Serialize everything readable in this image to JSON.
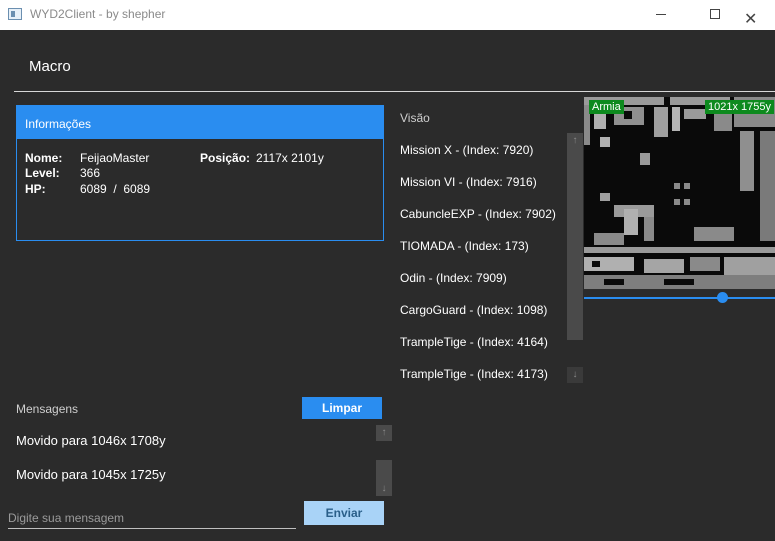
{
  "window": {
    "title": "WYD2Client - by shepher"
  },
  "header": {
    "tab_label": "Macro"
  },
  "info": {
    "title": "Informações",
    "name_label": "Nome:",
    "name_value": "FeijaoMaster",
    "position_label": "Posição:",
    "position_value": "2117x 2101y",
    "level_label": "Level:",
    "level_value": "366",
    "hp_label": "HP:",
    "hp_value": "6089  /  6089"
  },
  "vision": {
    "title": "Visão",
    "items": [
      "Mission X  - (Index: 7920)",
      "Mission VI  - (Index: 7916)",
      "CabuncleEXP  - (Index: 7902)",
      "TIOMADA  - (Index: 173)",
      "Odin  - (Index: 7909)",
      "CargoGuard  - (Index: 1098)",
      "TrampleTige  - (Index: 4164)",
      "TrampleTige  - (Index: 4173)"
    ]
  },
  "map": {
    "region_label": "Armia",
    "coords_label": "1021x 1755y",
    "zoom": 0.73
  },
  "messages": {
    "title": "Mensagens",
    "clear_label": "Limpar",
    "items": [
      "Movido para 1046x 1708y",
      "Movido para 1045x 1725y"
    ],
    "input_placeholder": "Digite sua mensagem",
    "send_label": "Enviar"
  },
  "colors": {
    "accent": "#2a8df0",
    "background": "#2b2b2b",
    "map_label": "#0d8a1e"
  }
}
